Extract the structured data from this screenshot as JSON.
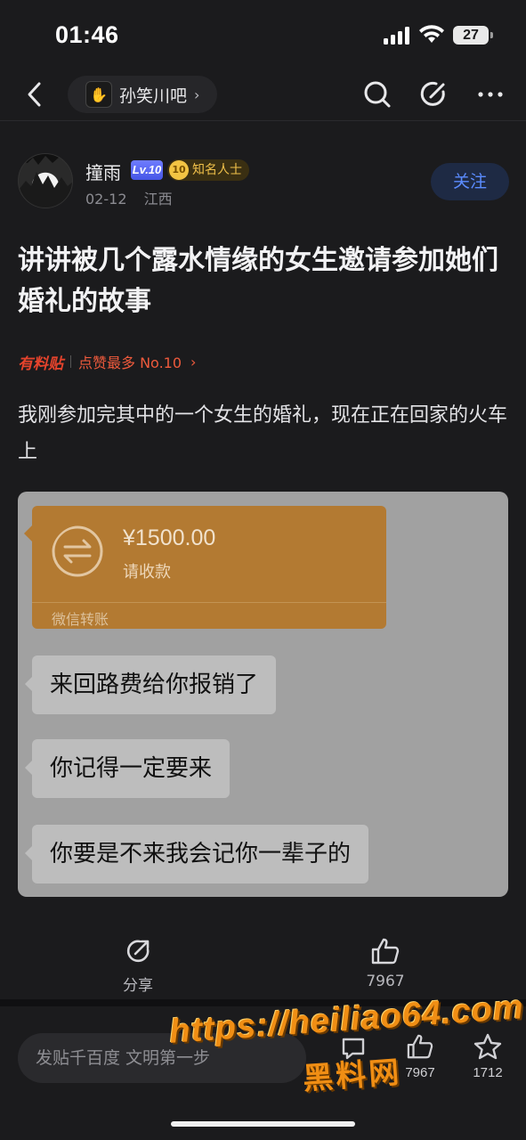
{
  "status_bar": {
    "time": "01:46",
    "battery": "27"
  },
  "nav": {
    "forum_name": "孙笑川吧",
    "forum_avatar_glyph": "✋"
  },
  "author": {
    "name": "撞雨",
    "level": "Lv.10",
    "title_badge": "知名人士",
    "title_badge_num": "10",
    "date": "02-12",
    "location": "江西",
    "follow_label": "关注"
  },
  "post": {
    "title": "讲讲被几个露水情缘的女生邀请参加她们婚礼的故事",
    "badge_label": "有料贴",
    "rank_text": "点赞最多 No.10",
    "body": "我刚参加完其中的一个女生的婚礼，现在正在回家的火车上"
  },
  "chat_image": {
    "transfer": {
      "amount": "¥1500.00",
      "request": "请收款",
      "brand": "微信转账"
    },
    "messages": [
      "来回路费给你报销了",
      "你记得一定要来",
      "你要是不来我会记你一辈子的"
    ]
  },
  "actions": {
    "share_label": "分享",
    "like_count": "7967"
  },
  "bottom_bar": {
    "reply_placeholder": "发贴千百度 文明第一步",
    "like_count": "7967",
    "fav_count": "1712"
  },
  "watermark": {
    "url": "https://heiliao64.com",
    "name": "黑料网"
  },
  "colors": {
    "accent_blue": "#5b8cff",
    "badge_red": "#e4432c",
    "transfer_orange": "#b37a32",
    "watermark_orange": "#f08e14"
  }
}
